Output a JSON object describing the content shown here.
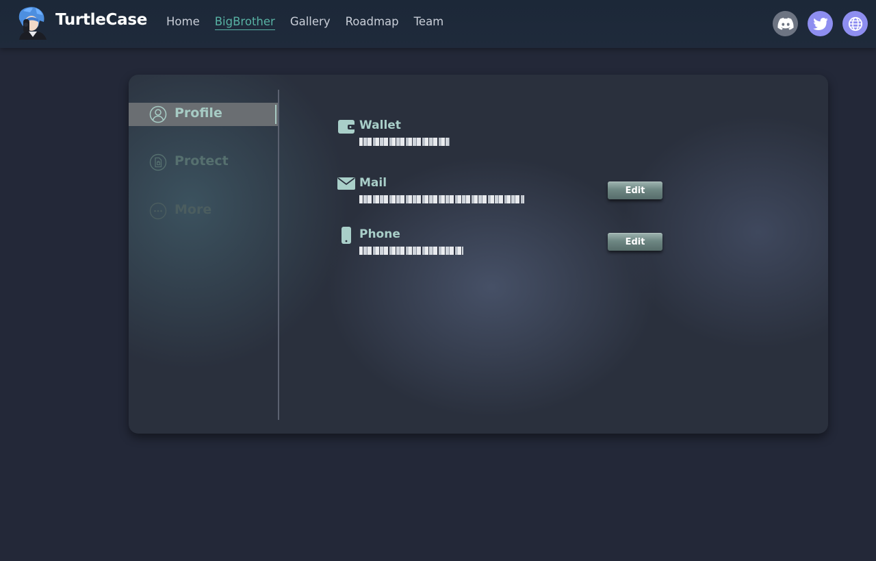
{
  "header": {
    "brand": "TurtleCase",
    "nav": [
      {
        "label": "Home",
        "active": false
      },
      {
        "label": "BigBrother",
        "active": true
      },
      {
        "label": "Gallery",
        "active": false
      },
      {
        "label": "Roadmap",
        "active": false
      },
      {
        "label": "Team",
        "active": false
      }
    ],
    "socials": [
      {
        "icon": "discord-icon"
      },
      {
        "icon": "twitter-icon"
      },
      {
        "icon": "globe-icon"
      }
    ]
  },
  "sidebar": {
    "items": [
      {
        "label": "Profile",
        "icon": "user-circle-icon",
        "active": true
      },
      {
        "label": "Protect",
        "icon": "document-lock-icon",
        "active": false
      },
      {
        "label": "More",
        "icon": "more-circle-icon",
        "active": false
      }
    ]
  },
  "profile": {
    "wallet": {
      "label": "Wallet",
      "icon": "wallet-icon"
    },
    "mail": {
      "label": "Mail",
      "icon": "mail-icon",
      "edit_label": "Edit"
    },
    "phone": {
      "label": "Phone",
      "icon": "phone-icon",
      "edit_label": "Edit"
    }
  },
  "colors": {
    "accent": "#58b2a4",
    "field_label": "#a9cfc9",
    "social_purple": "#8e8ef0",
    "social_gray": "#6d7482",
    "page_bg": "#232838",
    "card_bg": "#2a303d"
  }
}
